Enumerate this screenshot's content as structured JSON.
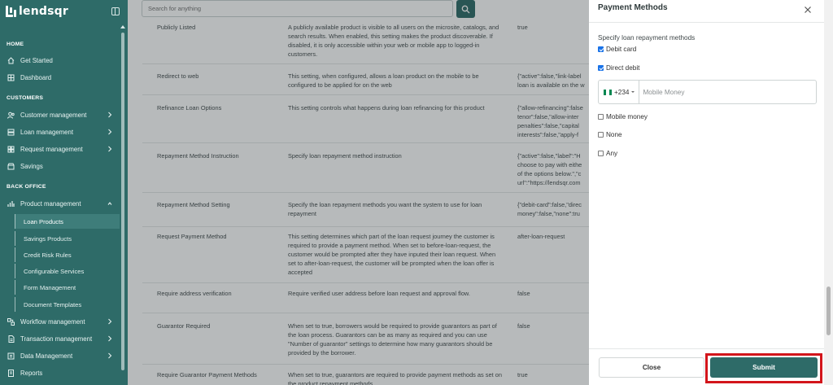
{
  "app": {
    "logo_text": "lendsqr"
  },
  "search": {
    "placeholder": "Search for anything"
  },
  "sidebar": {
    "sections": [
      {
        "heading": "HOME",
        "items": [
          {
            "label": "Get Started",
            "icon": "home-icon"
          },
          {
            "label": "Dashboard",
            "icon": "dashboard-icon"
          }
        ]
      },
      {
        "heading": "CUSTOMERS",
        "items": [
          {
            "label": "Customer management",
            "icon": "users-icon",
            "expandable": true
          },
          {
            "label": "Loan management",
            "icon": "loan-icon",
            "expandable": true
          },
          {
            "label": "Request management",
            "icon": "request-icon",
            "expandable": true
          },
          {
            "label": "Savings",
            "icon": "savings-icon"
          }
        ]
      },
      {
        "heading": "BACK OFFICE",
        "items": [
          {
            "label": "Product management",
            "icon": "product-icon",
            "expandable": true,
            "expanded": true
          }
        ]
      }
    ],
    "product_subitems": [
      "Loan Products",
      "Savings Products",
      "Credit Risk Rules",
      "Configurable Services",
      "Form Management",
      "Document Templates"
    ],
    "active_subitem": "Loan Products",
    "more_items": [
      {
        "label": "Workflow management",
        "icon": "workflow-icon",
        "expandable": true
      },
      {
        "label": "Transaction management",
        "icon": "transaction-icon",
        "expandable": true
      },
      {
        "label": "Data Management",
        "icon": "data-icon",
        "expandable": true
      },
      {
        "label": "Reports",
        "icon": "reports-icon"
      }
    ]
  },
  "settings_rows": [
    {
      "name": "Publicly Listed",
      "description": "A publicly available product is visible to all users on the microsite, catalogs, and search results. When enabled, this setting makes the product discoverable. If disabled, it is only accessible within your web or mobile app to logged-in customers.",
      "value": "true"
    },
    {
      "name": "Redirect to web",
      "description": "This setting, when configured, allows a loan product on the mobile to be configured to be applied for on the web",
      "value": "{\"active\":false,\"link-label\nloan is available on the w"
    },
    {
      "name": "Refinance Loan Options",
      "description": "This setting controls what happens during loan refinancing for this product",
      "value": "{\"allow-refinancing\":false\ntenor\":false,\"allow-inter\npenalties\":false,\"capital\ninterests\":false,\"apply-f"
    },
    {
      "name": "Repayment Method Instruction",
      "description": "Specify loan repayment method instruction",
      "value": "{\"active\":false,\"label\":\"H\nchoose to pay with eithe\nof the options below.\",\"c\nurl\":\"https://lendsqr.com"
    },
    {
      "name": "Repayment Method Setting",
      "description": "Specify the loan repayment methods you want the system to use for loan repayment",
      "value": "{\"debit-card\":false,\"direc\nmoney\":false,\"none\":tru"
    },
    {
      "name": "Request Payment Method",
      "description": "This setting determines which part of the loan request journey the customer is required to provide a payment method. When set to before-loan-request, the customer would be prompted after they have inputed their loan request. When set to after-loan-request, the customer will be prompted when the loan offer is accepted",
      "value": "after-loan-request"
    },
    {
      "name": "Require address verification",
      "description": "Require verified user address before loan request and approval flow.",
      "value": "false"
    },
    {
      "name": "Guarantor Required",
      "description": "When set to true, borrowers would be required to provide guarantors as part of the loan process. Guarantors can be as many as required and you can use \"Number of guarantor\" settings to determine how many guarantors should be provided by the borrower.",
      "value": "false"
    },
    {
      "name": "Require Guarantor Payment Methods",
      "description": "When set to true, guarantors are required to provide payment methods as set on the product repayment methods",
      "value": "true"
    }
  ],
  "drawer": {
    "title": "Payment Methods",
    "subtitle": "Specify loan repayment methods",
    "options_top": [
      {
        "label": "Debit card",
        "checked": true
      },
      {
        "label": "Direct debit",
        "checked": true
      }
    ],
    "phone": {
      "country_code": "+234",
      "flag": "nigeria-flag-icon",
      "placeholder": "Mobile Money",
      "value": ""
    },
    "options_bottom": [
      {
        "label": "Mobile money",
        "checked": false
      },
      {
        "label": "None",
        "checked": false
      },
      {
        "label": "Any",
        "checked": false
      }
    ],
    "close_label": "Close",
    "submit_label": "Submit"
  },
  "colors": {
    "brand": "#2e6b68",
    "highlight": "#d3151b",
    "checkbox": "#1a73e8"
  }
}
